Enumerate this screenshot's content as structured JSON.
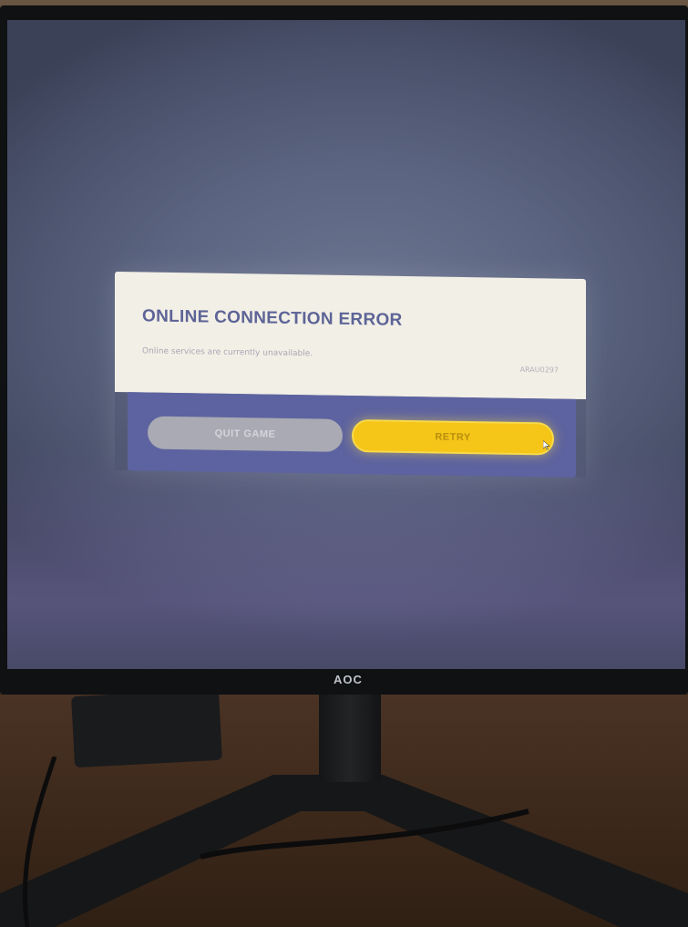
{
  "dialog": {
    "title": "ONLINE CONNECTION ERROR",
    "message": "Online services are currently unavailable.",
    "error_code": "ARAU0297",
    "buttons": {
      "quit_label": "QUIT GAME",
      "retry_label": "RETRY"
    }
  },
  "monitor": {
    "brand": "AOC"
  },
  "colors": {
    "dialog_background": "#f2efe6",
    "dialog_footer": "#5d63a0",
    "title_text": "#5d6497",
    "retry_button": "#f5c518",
    "quit_button": "#a9aab3"
  },
  "icons": {
    "cursor": "mouse-pointer-icon"
  }
}
